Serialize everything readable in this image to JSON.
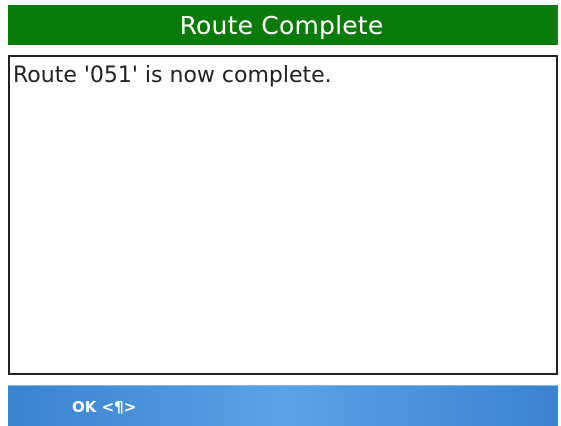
{
  "dialog": {
    "title": "Route Complete",
    "message": "Route '051' is now complete."
  },
  "softkeys": {
    "ok_label": "OK <¶>"
  },
  "colors": {
    "title_bar": "#0a7a0a",
    "softkey_bar": "#4a93d8",
    "text": "#222222"
  }
}
